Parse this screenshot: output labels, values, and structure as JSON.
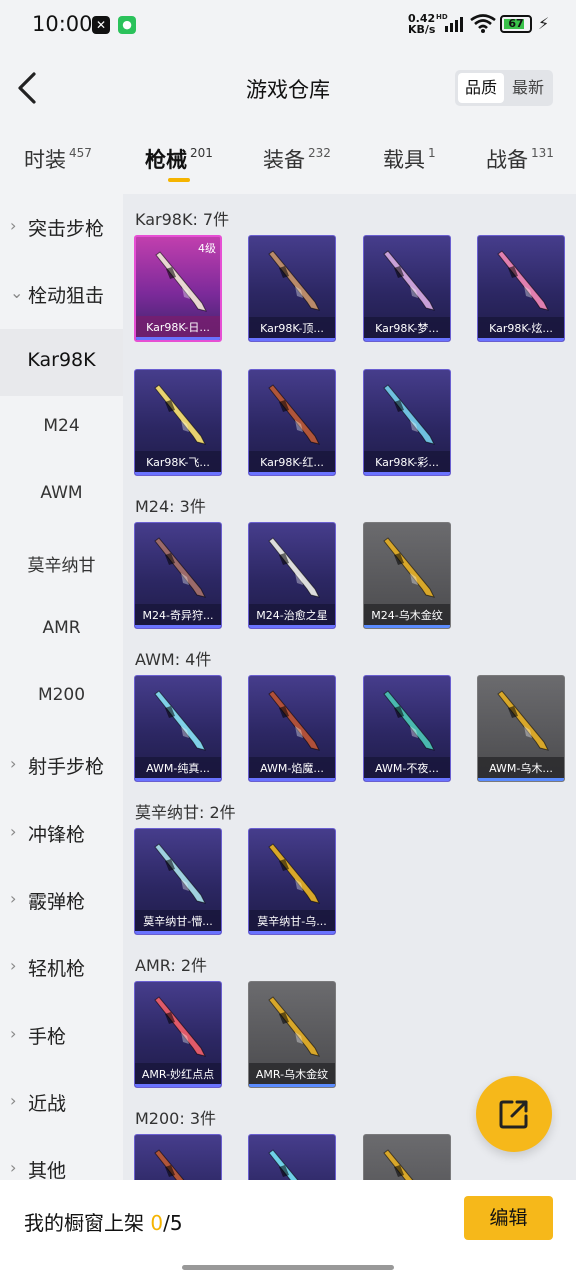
{
  "status_bar": {
    "time": "10:00",
    "net_speed": "0.42",
    "net_unit": "KB/s",
    "net_type": "HD",
    "battery": "67",
    "icons": [
      "capcut-icon",
      "wechat-icon",
      "signal-icon",
      "wifi-icon",
      "battery-icon",
      "charging-icon"
    ]
  },
  "header": {
    "title": "游戏仓库",
    "sort_options": [
      "品质",
      "最新"
    ],
    "active_sort": "品质"
  },
  "tabs": [
    {
      "label": "时装",
      "count": "457"
    },
    {
      "label": "枪械",
      "count": "201"
    },
    {
      "label": "装备",
      "count": "232"
    },
    {
      "label": "载具",
      "count": "1"
    },
    {
      "label": "战备",
      "count": "131"
    }
  ],
  "active_tab": "枪械",
  "sidebar": {
    "items": [
      {
        "label": "突击步枪",
        "type": "category",
        "expanded": false
      },
      {
        "label": "栓动狙击",
        "type": "category",
        "expanded": true
      },
      {
        "label": "Kar98K",
        "type": "sub",
        "selected": true
      },
      {
        "label": "M24",
        "type": "sub"
      },
      {
        "label": "AWM",
        "type": "sub"
      },
      {
        "label": "莫辛纳甘",
        "type": "sub"
      },
      {
        "label": "AMR",
        "type": "sub"
      },
      {
        "label": "M200",
        "type": "sub"
      },
      {
        "label": "射手步枪",
        "type": "category",
        "expanded": false
      },
      {
        "label": "冲锋枪",
        "type": "category",
        "expanded": false
      },
      {
        "label": "霰弹枪",
        "type": "category",
        "expanded": false
      },
      {
        "label": "轻机枪",
        "type": "category",
        "expanded": false
      },
      {
        "label": "手枪",
        "type": "category",
        "expanded": false
      },
      {
        "label": "近战",
        "type": "category",
        "expanded": false
      },
      {
        "label": "其他",
        "type": "category",
        "expanded": false
      }
    ]
  },
  "groups": [
    {
      "title": "Kar98K: 7件",
      "items": [
        {
          "name": "Kar98K-日...",
          "tier": "pink",
          "level": "4级",
          "gun_color": "#e9d7d2"
        },
        {
          "name": "Kar98K-顶...",
          "tier": "purple",
          "gun_color": "#b98a6a"
        },
        {
          "name": "Kar98K-梦...",
          "tier": "purple",
          "gun_color": "#c9a0d8"
        },
        {
          "name": "Kar98K-炫...",
          "tier": "purple",
          "gun_color": "#e07fb0"
        },
        {
          "name": "Kar98K-飞...",
          "tier": "purple",
          "gun_color": "#e8d270"
        },
        {
          "name": "Kar98K-红...",
          "tier": "purple",
          "gun_color": "#b0553a"
        },
        {
          "name": "Kar98K-彩...",
          "tier": "purple",
          "gun_color": "#6fc0e0"
        }
      ]
    },
    {
      "title": "M24: 3件",
      "items": [
        {
          "name": "M24-奇异狩...",
          "tier": "purple",
          "gun_color": "#9b6a6a"
        },
        {
          "name": "M24-治愈之星",
          "tier": "purple",
          "gun_color": "#dcdcdc"
        },
        {
          "name": "M24-乌木金纹",
          "tier": "gray",
          "gun_color": "#d8a72a"
        }
      ]
    },
    {
      "title": "AWM: 4件",
      "items": [
        {
          "name": "AWM-纯真...",
          "tier": "purple",
          "gun_color": "#7fd0e8"
        },
        {
          "name": "AWM-焰魔...",
          "tier": "purple",
          "gun_color": "#b0503a"
        },
        {
          "name": "AWM-不夜...",
          "tier": "purple",
          "gun_color": "#4ab8b0"
        },
        {
          "name": "AWM-乌木...",
          "tier": "gray",
          "gun_color": "#d8a72a"
        }
      ]
    },
    {
      "title": "莫辛纳甘: 2件",
      "items": [
        {
          "name": "莫辛纳甘-懵...",
          "tier": "purple",
          "gun_color": "#9fd0e0"
        },
        {
          "name": "莫辛纳甘-乌...",
          "tier": "purple",
          "gun_color": "#d8a72a"
        }
      ]
    },
    {
      "title": "AMR: 2件",
      "items": [
        {
          "name": "AMR-妙红点点",
          "tier": "purple",
          "gun_color": "#e05a6a"
        },
        {
          "name": "AMR-乌木金纹",
          "tier": "gray",
          "gun_color": "#d8a72a"
        }
      ]
    },
    {
      "title": "M200: 3件",
      "items": [
        {
          "name": "",
          "tier": "purple",
          "gun_color": "#b0553a"
        },
        {
          "name": "",
          "tier": "purple",
          "gun_color": "#6fd0e8"
        },
        {
          "name": "",
          "tier": "gray",
          "gun_color": "#d8a72a"
        }
      ]
    }
  ],
  "bottom_bar": {
    "caption_prefix": "我的橱窗上架 ",
    "shelf_count": "0",
    "shelf_total": "/5",
    "edit_label": "编辑"
  }
}
